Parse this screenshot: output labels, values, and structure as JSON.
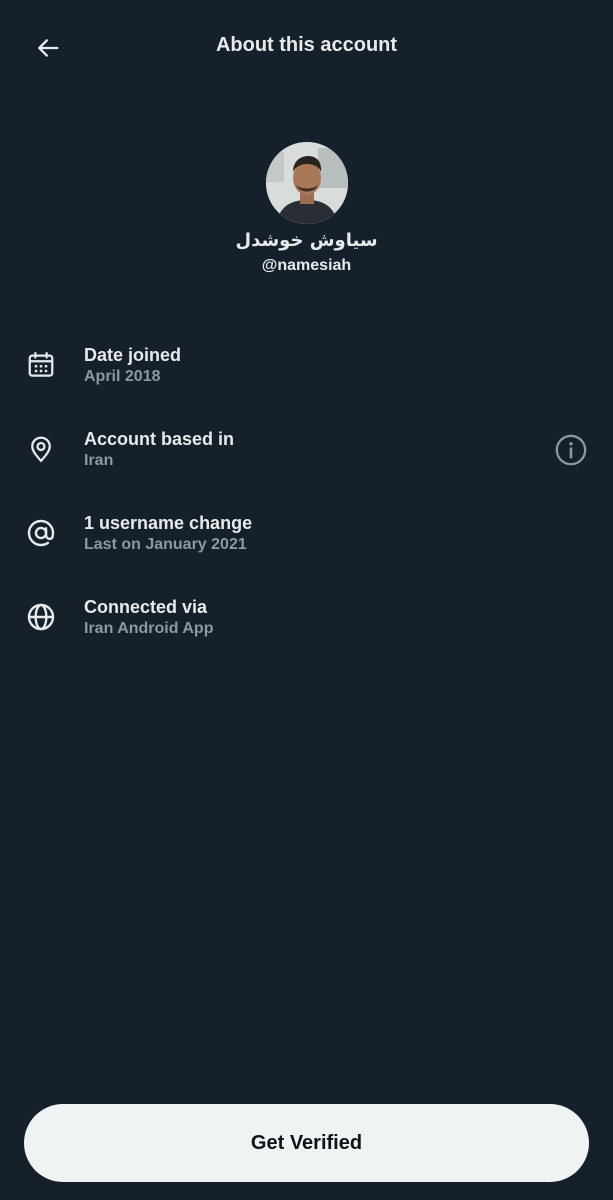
{
  "header": {
    "title": "About this account",
    "back_icon": "arrow-left-icon"
  },
  "profile": {
    "display_name": "سیاوش خوشدل",
    "handle": "@namesiah"
  },
  "info": [
    {
      "icon": "calendar-icon",
      "title": "Date joined",
      "subtitle": "April 2018"
    },
    {
      "icon": "location-pin-icon",
      "title": "Account based in",
      "subtitle": "Iran",
      "extra_icon": "info-circle-icon"
    },
    {
      "icon": "at-sign-icon",
      "title": "1 username change",
      "subtitle": "Last on January 2021"
    },
    {
      "icon": "globe-icon",
      "title": "Connected via",
      "subtitle": "Iran Android App"
    }
  ],
  "footer": {
    "verify_label": "Get Verified"
  },
  "colors": {
    "background": "#15202b",
    "primary_text": "#e7e9ea",
    "secondary_text": "#8b98a5",
    "button_bg": "#eff3f4",
    "button_text": "#0f1419"
  }
}
